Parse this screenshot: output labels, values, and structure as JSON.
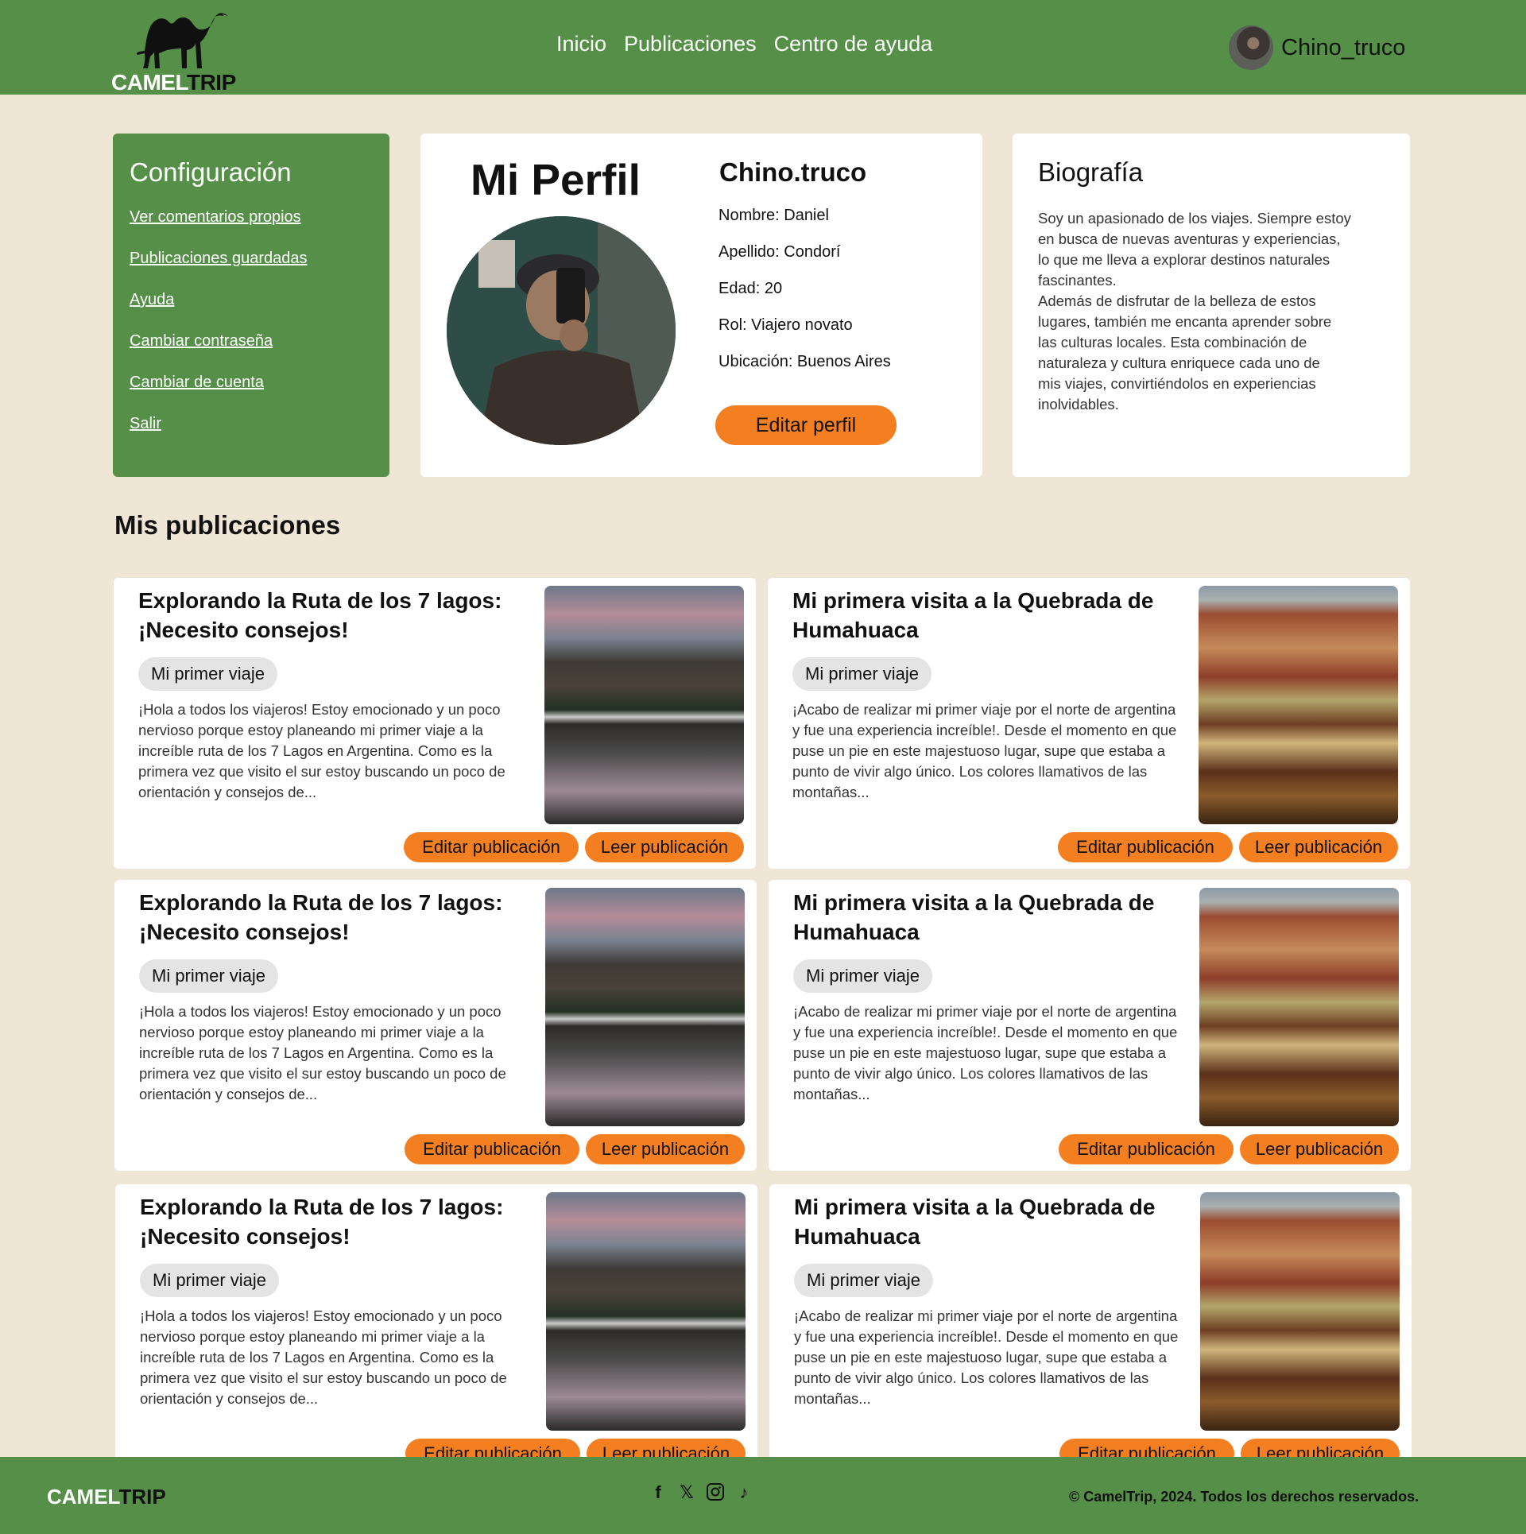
{
  "brand": {
    "name_part1": "CAMEL",
    "name_part2": "TRIP"
  },
  "nav": {
    "items": [
      "Inicio",
      "Publicaciones",
      "Centro de ayuda"
    ]
  },
  "user": {
    "name": "Chino_truco"
  },
  "config": {
    "title": "Configuración",
    "links": [
      "Ver comentarios propios",
      "Publicaciones guardadas",
      "Ayuda",
      "Cambiar contraseña",
      "Cambiar de cuenta",
      "Salir"
    ]
  },
  "profile": {
    "title": "Mi Perfil",
    "handle": "Chino.truco",
    "info": [
      "Nombre: Daniel",
      "Apellido: Condorí",
      "Edad: 20",
      "Rol: Viajero novato",
      "Ubicación: Buenos Aires"
    ],
    "edit_label": "Editar perfil"
  },
  "bio": {
    "title": "Biografía",
    "text": "Soy un apasionado de los viajes. Siempre estoy\nen busca de nuevas aventuras y experiencias,\nlo que me lleva a explorar destinos naturales\nfascinantes.\nAdemás de disfrutar de la belleza de estos\nlugares, también me encanta aprender sobre\nlas culturas locales. Esta combinación de\nnaturaleza y cultura enriquece cada uno de\nmis viajes, convirtiéndolos en experiencias\ninolvidables."
  },
  "posts_section": {
    "title": "Mis publicaciones"
  },
  "posts": [
    {
      "title": "Explorando la Ruta de los 7 lagos: ¡Necesito consejos!",
      "tag": "Mi primer viaje",
      "text": "¡Hola a todos los viajeros! Estoy emocionado y un poco nervioso porque estoy planeando mi primer viaje a la increíble ruta de los 7 Lagos en Argentina. Como es la primera vez que visito el sur estoy buscando un poco de orientación y consejos de...",
      "image": "lake",
      "edit_label": "Editar publicación",
      "read_label": "Leer publicación"
    },
    {
      "title": "Mi primera visita a la Quebrada de Humahuaca",
      "tag": "Mi primer viaje",
      "text": "¡Acabo de realizar mi primer viaje por el norte de argentina y fue una experiencia increíble!. Desde el momento en que puse un pie en este majestuoso lugar, supe que estaba a punto de vivir algo único. Los colores llamativos de las montañas...",
      "image": "quebrada",
      "edit_label": "Editar publicación",
      "read_label": "Leer publicación"
    },
    {
      "title": "Explorando la Ruta de los 7 lagos: ¡Necesito consejos!",
      "tag": "Mi primer viaje",
      "text": "¡Hola a todos los viajeros! Estoy emocionado y un poco nervioso porque estoy planeando mi primer viaje a la increíble ruta de los 7 Lagos en Argentina. Como es la primera vez que visito el sur estoy buscando un poco de orientación y consejos de...",
      "image": "lake",
      "edit_label": "Editar publicación",
      "read_label": "Leer publicación"
    },
    {
      "title": "Mi primera visita a la Quebrada de Humahuaca",
      "tag": "Mi primer viaje",
      "text": "¡Acabo de realizar mi primer viaje por el norte de argentina y fue una experiencia increíble!. Desde el momento en que puse un pie en este majestuoso lugar, supe que estaba a punto de vivir algo único. Los colores llamativos de las montañas...",
      "image": "quebrada",
      "edit_label": "Editar publicación",
      "read_label": "Leer publicación"
    },
    {
      "title": "Explorando la Ruta de los 7 lagos: ¡Necesito consejos!",
      "tag": "Mi primer viaje",
      "text": "¡Hola a todos los viajeros! Estoy emocionado y un poco nervioso porque estoy planeando mi primer viaje a la increíble ruta de los 7 Lagos en Argentina. Como es la primera vez que visito el sur estoy buscando un poco de orientación y consejos de...",
      "image": "lake",
      "edit_label": "Editar publicación",
      "read_label": "Leer publicación"
    },
    {
      "title": "Mi primera visita a la Quebrada de Humahuaca",
      "tag": "Mi primer viaje",
      "text": "¡Acabo de realizar mi primer viaje por el norte de argentina y fue una experiencia increíble!. Desde el momento en que puse un pie en este majestuoso lugar, supe que estaba a punto de vivir algo único. Los colores llamativos de las montañas...",
      "image": "quebrada",
      "edit_label": "Editar publicación",
      "read_label": "Leer publicación"
    }
  ],
  "footer": {
    "copyright": "© CamelTrip, 2024. Todos los derechos reservados.",
    "social": [
      "facebook-icon",
      "x-icon",
      "instagram-icon",
      "tiktok-icon"
    ]
  },
  "colors": {
    "green": "#558f48",
    "orange": "#f47f20",
    "background": "#f0e6d6"
  }
}
